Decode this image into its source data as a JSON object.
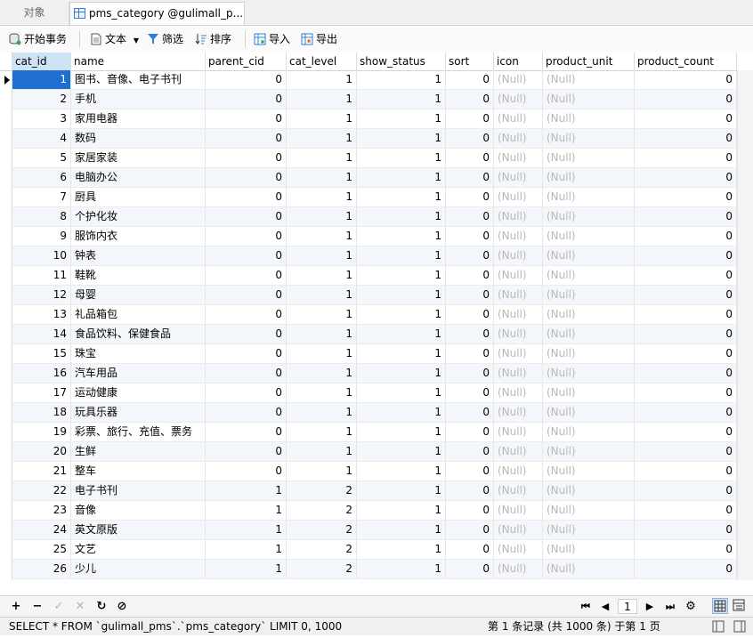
{
  "tabs": {
    "objects": "对象",
    "table": "pms_category @gulimall_p..."
  },
  "toolbar": {
    "begin": "开始事务",
    "text": "文本",
    "filter": "筛选",
    "sort": "排序",
    "import": "导入",
    "export": "导出"
  },
  "columns": [
    "cat_id",
    "name",
    "parent_cid",
    "cat_level",
    "show_status",
    "sort",
    "icon",
    "product_unit",
    "product_count"
  ],
  "rows": [
    [
      1,
      "图书、音像、电子书刊",
      0,
      1,
      1,
      0,
      "(Null)",
      "(Null)",
      0
    ],
    [
      2,
      "手机",
      0,
      1,
      1,
      0,
      "(Null)",
      "(Null)",
      0
    ],
    [
      3,
      "家用电器",
      0,
      1,
      1,
      0,
      "(Null)",
      "(Null)",
      0
    ],
    [
      4,
      "数码",
      0,
      1,
      1,
      0,
      "(Null)",
      "(Null)",
      0
    ],
    [
      5,
      "家居家装",
      0,
      1,
      1,
      0,
      "(Null)",
      "(Null)",
      0
    ],
    [
      6,
      "电脑办公",
      0,
      1,
      1,
      0,
      "(Null)",
      "(Null)",
      0
    ],
    [
      7,
      "厨具",
      0,
      1,
      1,
      0,
      "(Null)",
      "(Null)",
      0
    ],
    [
      8,
      "个护化妆",
      0,
      1,
      1,
      0,
      "(Null)",
      "(Null)",
      0
    ],
    [
      9,
      "服饰内衣",
      0,
      1,
      1,
      0,
      "(Null)",
      "(Null)",
      0
    ],
    [
      10,
      "钟表",
      0,
      1,
      1,
      0,
      "(Null)",
      "(Null)",
      0
    ],
    [
      11,
      "鞋靴",
      0,
      1,
      1,
      0,
      "(Null)",
      "(Null)",
      0
    ],
    [
      12,
      "母婴",
      0,
      1,
      1,
      0,
      "(Null)",
      "(Null)",
      0
    ],
    [
      13,
      "礼品箱包",
      0,
      1,
      1,
      0,
      "(Null)",
      "(Null)",
      0
    ],
    [
      14,
      "食品饮料、保健食品",
      0,
      1,
      1,
      0,
      "(Null)",
      "(Null)",
      0
    ],
    [
      15,
      "珠宝",
      0,
      1,
      1,
      0,
      "(Null)",
      "(Null)",
      0
    ],
    [
      16,
      "汽车用品",
      0,
      1,
      1,
      0,
      "(Null)",
      "(Null)",
      0
    ],
    [
      17,
      "运动健康",
      0,
      1,
      1,
      0,
      "(Null)",
      "(Null)",
      0
    ],
    [
      18,
      "玩具乐器",
      0,
      1,
      1,
      0,
      "(Null)",
      "(Null)",
      0
    ],
    [
      19,
      "彩票、旅行、充值、票务",
      0,
      1,
      1,
      0,
      "(Null)",
      "(Null)",
      0
    ],
    [
      20,
      "生鲜",
      0,
      1,
      1,
      0,
      "(Null)",
      "(Null)",
      0
    ],
    [
      21,
      "整车",
      0,
      1,
      1,
      0,
      "(Null)",
      "(Null)",
      0
    ],
    [
      22,
      "电子书刊",
      1,
      2,
      1,
      0,
      "(Null)",
      "(Null)",
      0
    ],
    [
      23,
      "音像",
      1,
      2,
      1,
      0,
      "(Null)",
      "(Null)",
      0
    ],
    [
      24,
      "英文原版",
      1,
      2,
      1,
      0,
      "(Null)",
      "(Null)",
      0
    ],
    [
      25,
      "文艺",
      1,
      2,
      1,
      0,
      "(Null)",
      "(Null)",
      0
    ],
    [
      26,
      "少儿",
      1,
      2,
      1,
      0,
      "(Null)",
      "(Null)",
      0
    ]
  ],
  "nav": {
    "page": "1"
  },
  "status": {
    "sql": "SELECT * FROM `gulimall_pms`.`pms_category` LIMIT 0, 1000",
    "records": "第 1 条记录 (共 1000 条) 于第 1 页"
  }
}
